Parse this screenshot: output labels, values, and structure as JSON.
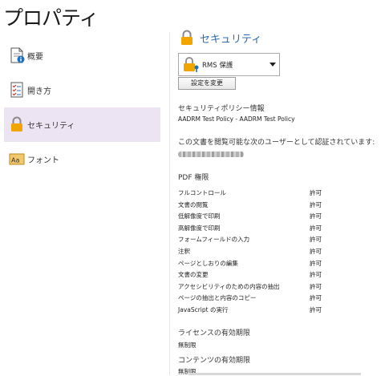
{
  "title": "プロパティ",
  "sidebar": {
    "items": [
      {
        "label": "概要",
        "icon": "document-info-icon"
      },
      {
        "label": "開き方",
        "icon": "checklist-icon"
      },
      {
        "label": "セキュリティ",
        "icon": "lock-icon",
        "active": true
      },
      {
        "label": "フォント",
        "icon": "font-icon"
      }
    ]
  },
  "security": {
    "heading": "セキュリティ",
    "dropdown_value": "RMS 保護",
    "change_button": "設定を変更",
    "policy_info_label": "セキュリティポリシー情報",
    "policy_name": "AADRM Test Policy - AADRM Test Policy",
    "auth_message": "この文書を閲覧可能な次のユーザーとして認証されています:",
    "pdf_permissions_label": "PDF 権限",
    "permissions": [
      {
        "name": "フルコントロール",
        "value": "許可"
      },
      {
        "name": "文書の閲覧",
        "value": "許可"
      },
      {
        "name": "低解像度で印刷",
        "value": "許可"
      },
      {
        "name": "高解像度で印刷",
        "value": "許可"
      },
      {
        "name": "フォームフィールドの入力",
        "value": "許可"
      },
      {
        "name": "注釈",
        "value": "許可"
      },
      {
        "name": "ページとしおりの編集",
        "value": "許可"
      },
      {
        "name": "文書の変更",
        "value": "許可"
      },
      {
        "name": "アクセシビリティのための内容の抽出",
        "value": "許可"
      },
      {
        "name": "ページの抽出と内容のコピー",
        "value": "許可"
      },
      {
        "name": "JavaScript の実行",
        "value": "許可"
      }
    ],
    "license_expiry_label": "ライセンスの有効期限",
    "license_expiry_value": "無制限",
    "content_expiry_label": "コンテンツの有効期限",
    "content_expiry_value": "無制限"
  },
  "colors": {
    "accent": "#2b6cb0",
    "active_bg": "#ece4f2",
    "lock": "#f0a500"
  }
}
